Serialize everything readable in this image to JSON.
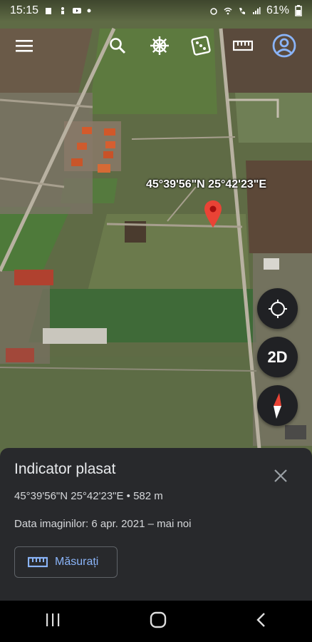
{
  "status_bar": {
    "time": "15:15",
    "battery": "61%"
  },
  "topbar": {
    "menu_icon": "menu-icon",
    "search_icon": "search-icon",
    "voyager_icon": "ship-wheel-icon",
    "feeling_lucky_icon": "dice-icon",
    "measure_icon": "ruler-icon",
    "account_icon": "account-icon"
  },
  "map": {
    "coordinate_label": "45°39'56\"N 25°42'23\"E",
    "mode_button": "2D"
  },
  "panel": {
    "title": "Indicator plasat",
    "coords_line": "45°39'56\"N 25°42'23\"E • 582 m",
    "imagery_line": "Data imaginilor: 6 apr. 2021 – mai noi",
    "measure_button": "Măsurați"
  },
  "colors": {
    "accent": "#8ab4f8",
    "pin": "#ea4335",
    "panel_bg": "#28292c"
  }
}
